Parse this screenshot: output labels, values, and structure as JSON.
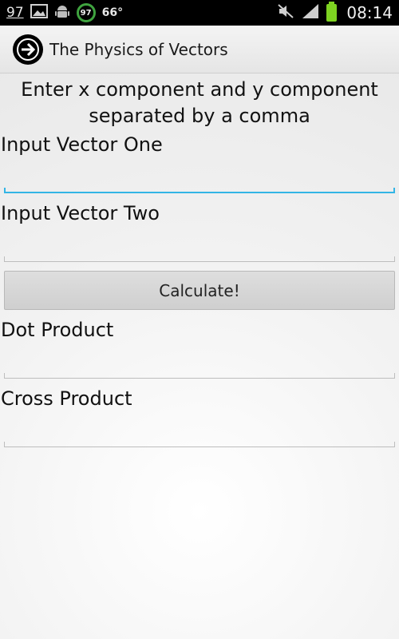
{
  "status_bar": {
    "notification_count": "97",
    "ring_value": "97",
    "temperature": "66°",
    "time": "08:14"
  },
  "action_bar": {
    "title": "The Physics of Vectors",
    "icon": "arrow-right-icon"
  },
  "main": {
    "instructions": "Enter x component and y component separated by a comma",
    "vector_one": {
      "label": "Input Vector One",
      "value": ""
    },
    "vector_two": {
      "label": "Input Vector Two",
      "value": ""
    },
    "calculate_label": "Calculate!",
    "dot_product": {
      "label": "Dot Product",
      "value": ""
    },
    "cross_product": {
      "label": "Cross Product",
      "value": ""
    }
  },
  "colors": {
    "focus_accent": "#33b5e5",
    "battery": "#7ed321",
    "ring": "#3fa33f"
  }
}
